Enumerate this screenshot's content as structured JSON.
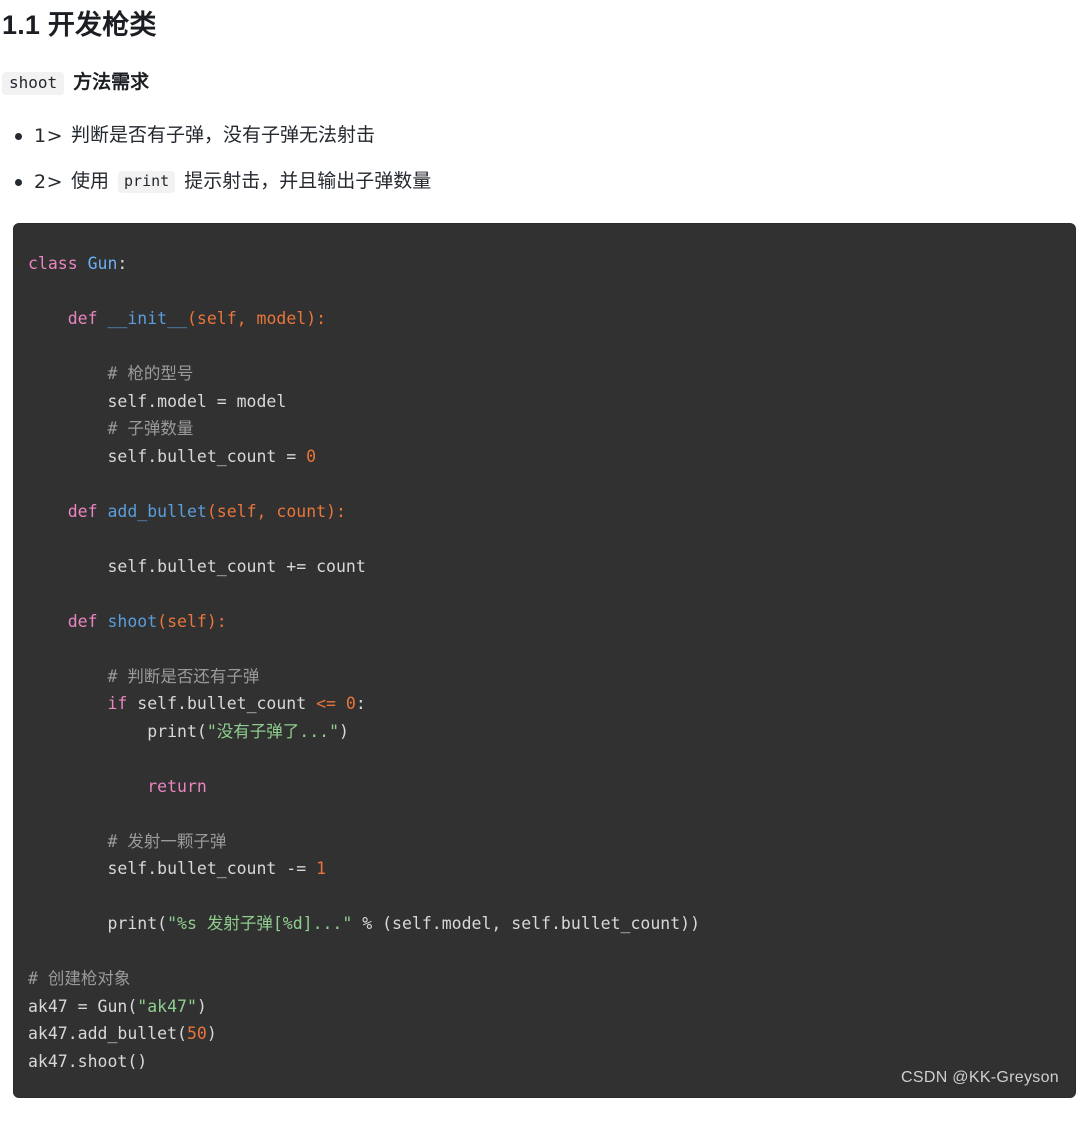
{
  "heading": {
    "text": "1.1 开发枪类"
  },
  "subheading": {
    "code": "shoot",
    "text": "方法需求"
  },
  "requirements": [
    {
      "index": "1>",
      "text_before": "判断是否有子弹，没有子弹无法射击",
      "code": "",
      "text_after": ""
    },
    {
      "index": "2>",
      "text_before": "使用",
      "code": "print",
      "text_after": "提示射击，并且输出子弹数量"
    }
  ],
  "code_block": {
    "language": "python",
    "background": "#313131",
    "colors": {
      "keyword": "#e985c0",
      "class_name": "#6ab0f3",
      "function_name": "#5b9ddb",
      "punctuation": "#e8753a",
      "number": "#e8753a",
      "string": "#8fce8f",
      "comment": "#9a9a9a",
      "plain": "#d8d8d8"
    },
    "lines": [
      "class Gun:",
      "",
      "    def __init__(self, model):",
      "",
      "        # 枪的型号",
      "        self.model = model",
      "        # 子弹数量",
      "        self.bullet_count = 0",
      "",
      "    def add_bullet(self, count):",
      "",
      "        self.bullet_count += count",
      "",
      "    def shoot(self):",
      "",
      "        # 判断是否还有子弹",
      "        if self.bullet_count <= 0:",
      "            print(\"没有子弹了...\")",
      "",
      "            return",
      "",
      "        # 发射一颗子弹",
      "        self.bullet_count -= 1",
      "",
      "        print(\"%s 发射子弹[%d]...\" % (self.model, self.bullet_count))",
      "",
      "# 创建枪对象",
      "ak47 = Gun(\"ak47\")",
      "ak47.add_bullet(50)",
      "ak47.shoot()"
    ],
    "tokens": {
      "kw_class": "class",
      "cls_gun": "Gun",
      "kw_def": "def",
      "fn_init": "__init__",
      "fn_add_bullet": "add_bullet",
      "fn_shoot": "shoot",
      "kw_if": "if",
      "kw_return": "return",
      "param_self": "self",
      "param_model": "model",
      "param_count": "count",
      "comment_model": "# 枪的型号",
      "comment_count": "# 子弹数量",
      "comment_check": "# 判断是否还有子弹",
      "comment_fire": "# 发射一颗子弹",
      "comment_create": "# 创建枪对象",
      "str_no_bullet": "\"没有子弹了...\"",
      "str_fire": "\"%s 发射子弹[%d]...\"",
      "str_ak47": "\"ak47\"",
      "num_zero": "0",
      "num_one": "1",
      "num_fifty": "50"
    }
  },
  "watermark": {
    "text": "CSDN @KK-Greyson"
  }
}
